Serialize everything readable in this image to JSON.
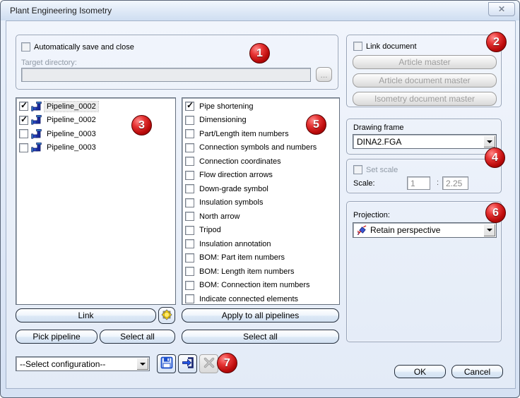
{
  "window": {
    "title": "Plant Engineering Isometry"
  },
  "icons": {
    "close": "✕",
    "dropdown": "▼"
  },
  "auto_save_group": {
    "checkbox_label": "Automatically save and close",
    "dir_label": "Target directory:",
    "dir_value": "",
    "browse_label": "..."
  },
  "link_document_group": {
    "checkbox_label": "Link document",
    "buttons": [
      "Article master",
      "Article document master",
      "Isometry document master"
    ]
  },
  "pipeline_list": {
    "items": [
      {
        "label": "Pipeline_0002",
        "checked": true,
        "selected": true
      },
      {
        "label": "Pipeline_0002",
        "checked": true
      },
      {
        "label": "Pipeline_0003",
        "checked": false
      },
      {
        "label": "Pipeline_0003",
        "checked": false
      }
    ]
  },
  "options_list": {
    "items": [
      {
        "label": "Pipe shortening",
        "checked": true
      },
      {
        "label": "Dimensioning",
        "checked": false
      },
      {
        "label": "Part/Length item numbers",
        "checked": false
      },
      {
        "label": "Connection symbols and numbers",
        "checked": false
      },
      {
        "label": "Connection coordinates",
        "checked": false
      },
      {
        "label": "Flow direction arrows",
        "checked": false
      },
      {
        "label": "Down-grade symbol",
        "checked": false
      },
      {
        "label": "Insulation symbols",
        "checked": false
      },
      {
        "label": "North arrow",
        "checked": false
      },
      {
        "label": "Tripod",
        "checked": false
      },
      {
        "label": "Insulation annotation",
        "checked": false
      },
      {
        "label": "BOM: Part item numbers",
        "checked": false
      },
      {
        "label": "BOM: Length item numbers",
        "checked": false
      },
      {
        "label": "BOM: Connection item numbers",
        "checked": false
      },
      {
        "label": "Indicate connected elements",
        "checked": false
      }
    ]
  },
  "pipeline_actions": {
    "link": "Link",
    "pick": "Pick pipeline",
    "select_all": "Select all"
  },
  "option_actions": {
    "apply_all": "Apply to all pipelines",
    "select_all": "Select all"
  },
  "drawing_frame_group": {
    "label": "Drawing frame",
    "value": "DINA2.FGA"
  },
  "scale_group": {
    "checkbox_label": "Set scale",
    "scale_label": "Scale:",
    "numerator": "1",
    "separator": ":",
    "denominator": "2.25"
  },
  "projection_group": {
    "label": "Projection:",
    "value": "Retain perspective"
  },
  "configuration": {
    "value": "--Select configuration--"
  },
  "footer": {
    "ok": "OK",
    "cancel": "Cancel"
  },
  "annotations": [
    "1",
    "2",
    "3",
    "4",
    "5",
    "6",
    "7"
  ],
  "colors": {
    "annotation_red": "#bb0b0b",
    "frame_blue": "#d5e1f3",
    "client_bg": "#edf3fb",
    "accent_icon_blue": "#1b4ecb",
    "gear_yellow": "#ffd800"
  }
}
